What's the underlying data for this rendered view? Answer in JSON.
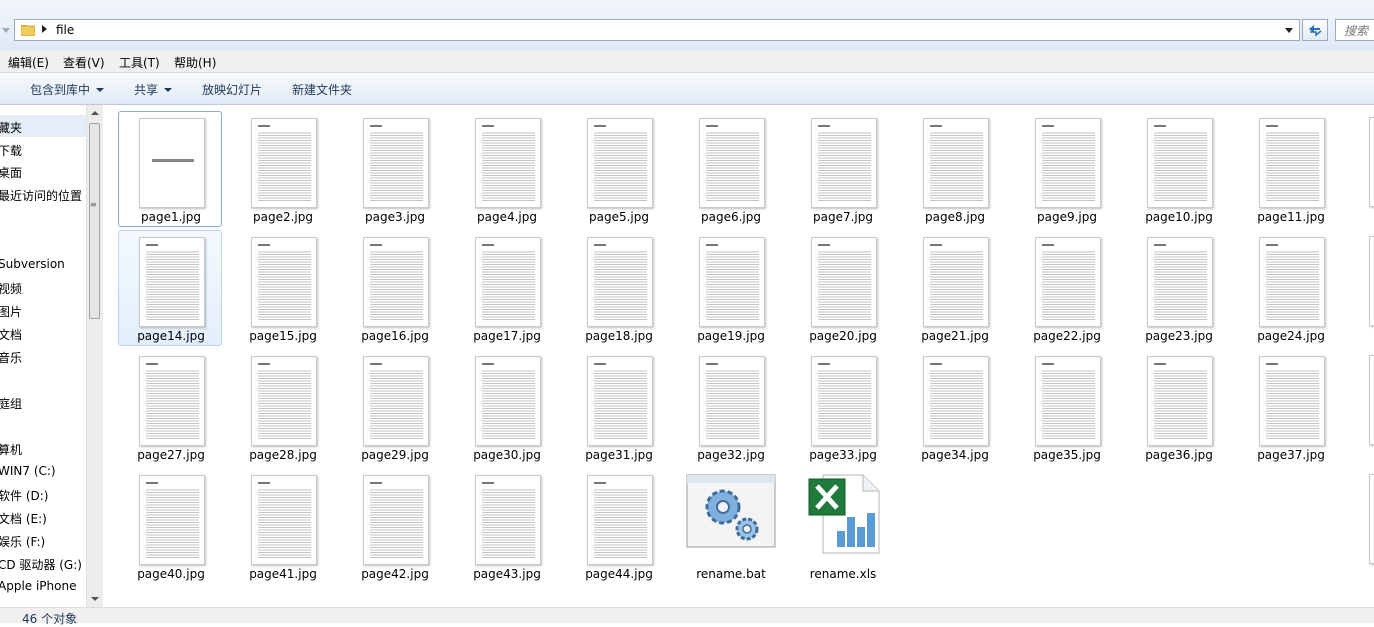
{
  "address": {
    "path": "file",
    "search_placeholder": "搜索"
  },
  "menu": [
    "编辑(E)",
    "查看(V)",
    "工具(T)",
    "帮助(H)"
  ],
  "toolbar": {
    "library": "包含到库中",
    "share": "共享",
    "slideshow": "放映幻灯片",
    "new_folder": "新建文件夹"
  },
  "nav": [
    "藏夹",
    "下载",
    "桌面",
    "最近访问的位置",
    "Subversion",
    "视频",
    "图片",
    "文档",
    "音乐",
    "庭组",
    "算机",
    "WIN7 (C:)",
    "软件 (D:)",
    "文档 (E:)",
    "娱乐 (F:)",
    "CD 驱动器 (G:)",
    "Apple iPhone"
  ],
  "files": [
    "page1.jpg",
    "page2.jpg",
    "page3.jpg",
    "page4.jpg",
    "page5.jpg",
    "page6.jpg",
    "page7.jpg",
    "page8.jpg",
    "page9.jpg",
    "page10.jpg",
    "page11.jpg",
    "page14.jpg",
    "page15.jpg",
    "page16.jpg",
    "page17.jpg",
    "page18.jpg",
    "page19.jpg",
    "page20.jpg",
    "page21.jpg",
    "page22.jpg",
    "page23.jpg",
    "page24.jpg",
    "page27.jpg",
    "page28.jpg",
    "page29.jpg",
    "page30.jpg",
    "page31.jpg",
    "page32.jpg",
    "page33.jpg",
    "page34.jpg",
    "page35.jpg",
    "page36.jpg",
    "page37.jpg",
    "page40.jpg",
    "page41.jpg",
    "page42.jpg",
    "page43.jpg",
    "page44.jpg",
    "rename.bat",
    "rename.xls"
  ],
  "status": {
    "count": "46 个对象"
  }
}
